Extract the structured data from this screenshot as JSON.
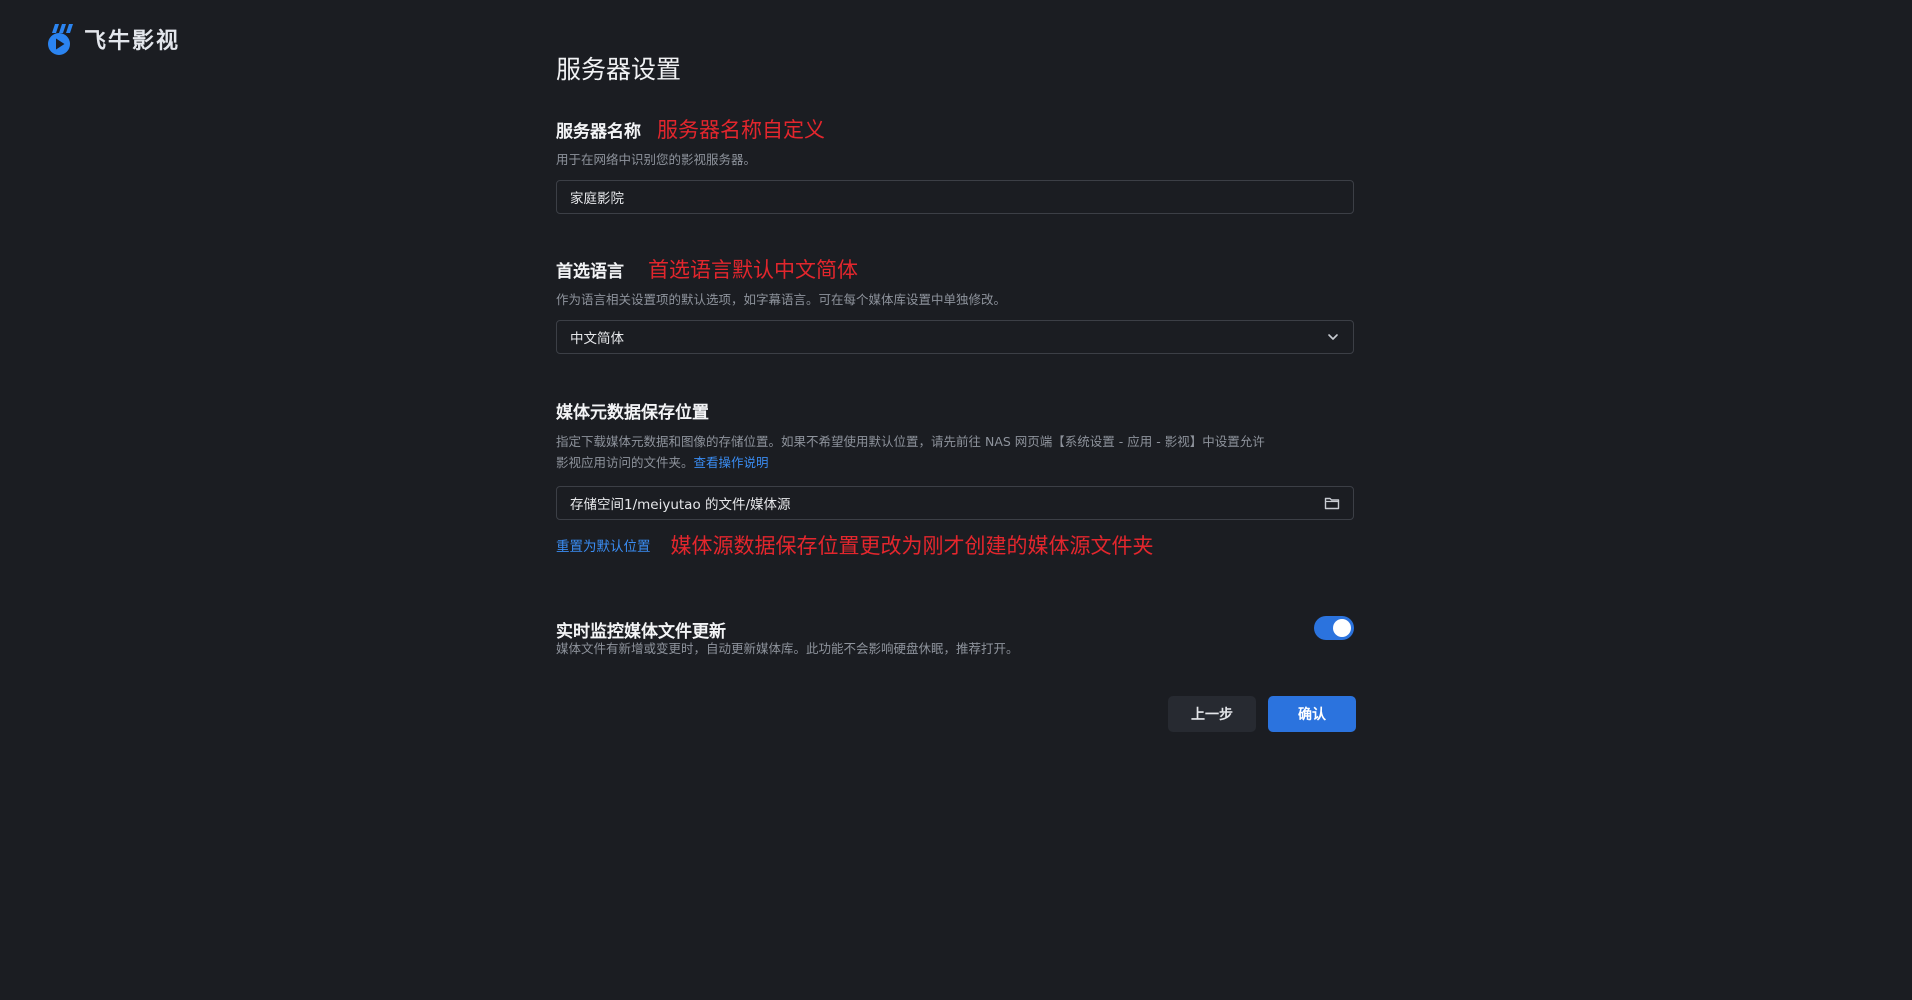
{
  "app": {
    "name": "飞牛影视"
  },
  "page": {
    "title": "服务器设置"
  },
  "server_name": {
    "label": "服务器名称",
    "annotation": "服务器名称自定义",
    "description": "用于在网络中识别您的影视服务器。",
    "value": "家庭影院"
  },
  "language": {
    "label": "首选语言",
    "annotation": "首选语言默认中文简体",
    "description": "作为语言相关设置项的默认选项，如字幕语言。可在每个媒体库设置中单独修改。",
    "selected": "中文简体"
  },
  "metadata_location": {
    "label": "媒体元数据保存位置",
    "description_line1": "指定下载媒体元数据和图像的存储位置。如果不希望使用默认位置，请先前往 NAS 网页端【系统设置 - 应用 - 影视】中设置允许",
    "description_line2": "影视应用访问的文件夹。",
    "help_link": "查看操作说明",
    "path": "存储空间1/meiyutao 的文件/媒体源",
    "reset_link": "重置为默认位置",
    "annotation": "媒体源数据保存位置更改为刚才创建的媒体源文件夹"
  },
  "realtime_monitor": {
    "label": "实时监控媒体文件更新",
    "description": "媒体文件有新增或变更时，自动更新媒体库。此功能不会影响硬盘休眠，推荐打开。",
    "enabled": true
  },
  "buttons": {
    "prev": "上一步",
    "confirm": "确认"
  },
  "colors": {
    "accent": "#2b73de",
    "annotation": "#e3262d",
    "background": "#1b1d22"
  },
  "icons": {
    "select": "chevron-down-icon",
    "folder": "folder-icon",
    "logo": "logo-icon"
  }
}
